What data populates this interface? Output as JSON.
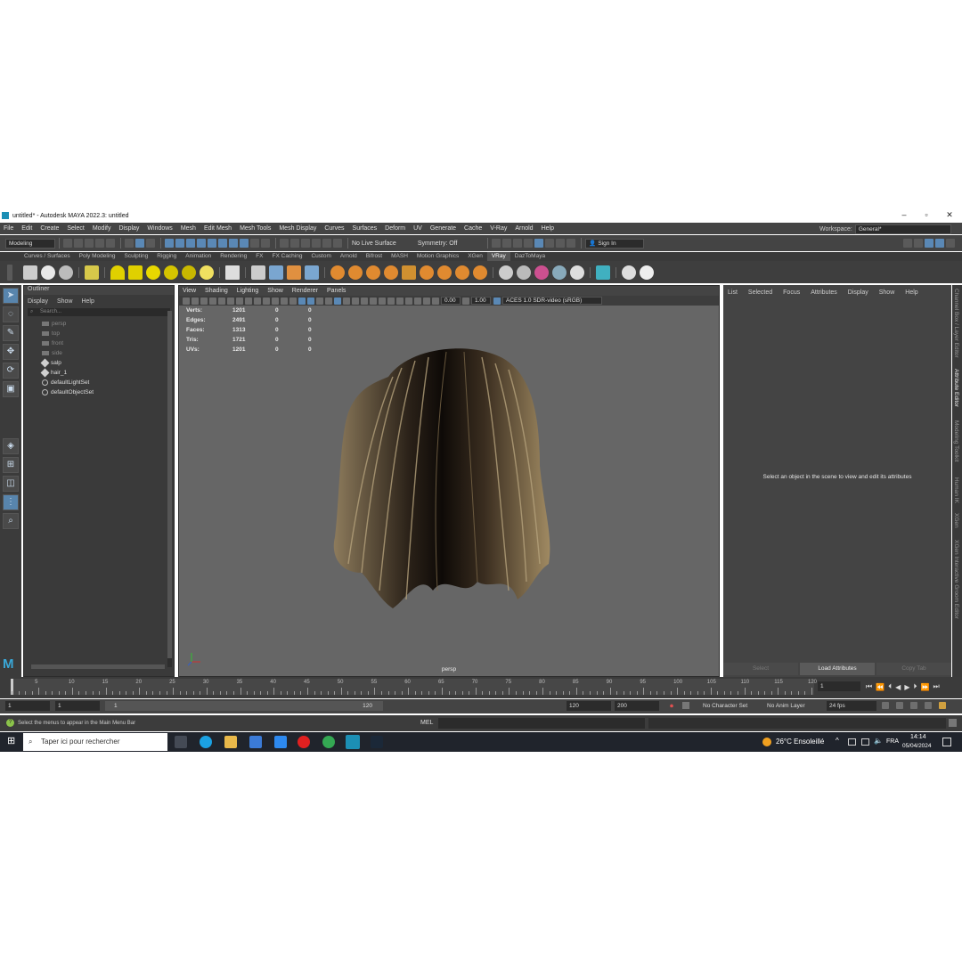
{
  "window": {
    "title": "untitled* - Autodesk MAYA 2022.3: untitled"
  },
  "menubar": {
    "items": [
      "File",
      "Edit",
      "Create",
      "Select",
      "Modify",
      "Display",
      "Windows",
      "Mesh",
      "Edit Mesh",
      "Mesh Tools",
      "Mesh Display",
      "Curves",
      "Surfaces",
      "Deform",
      "UV",
      "Generate",
      "Cache",
      "V-Ray",
      "Arnold",
      "Help"
    ],
    "workspace_label": "Workspace:",
    "workspace_value": "General*"
  },
  "statusline": {
    "mode": "Modeling",
    "live_surface": "No Live Surface",
    "symmetry": "Symmetry: Off",
    "sign_in": "Sign In"
  },
  "shelf": {
    "tabs": [
      "Curves / Surfaces",
      "Poly Modeling",
      "Sculpting",
      "Rigging",
      "Animation",
      "Rendering",
      "FX",
      "FX Caching",
      "Custom",
      "Arnold",
      "Bifrost",
      "MASH",
      "Motion Graphics",
      "XGen",
      "VRay",
      "DazToMaya"
    ],
    "active_tab": "VRay"
  },
  "outliner": {
    "title": "Outliner",
    "menu": [
      "Display",
      "Show",
      "Help"
    ],
    "search_placeholder": "Search...",
    "items": [
      {
        "label": "persp",
        "kind": "camera",
        "dim": true
      },
      {
        "label": "top",
        "kind": "camera",
        "dim": true
      },
      {
        "label": "front",
        "kind": "camera",
        "dim": true
      },
      {
        "label": "side",
        "kind": "camera",
        "dim": true
      },
      {
        "label": "salp",
        "kind": "mesh",
        "dim": false
      },
      {
        "label": "hair_1",
        "kind": "mesh",
        "dim": false
      },
      {
        "label": "defaultLightSet",
        "kind": "set",
        "dim": false
      },
      {
        "label": "defaultObjectSet",
        "kind": "set",
        "dim": false
      }
    ]
  },
  "viewport": {
    "menu": [
      "View",
      "Shading",
      "Lighting",
      "Show",
      "Renderer",
      "Panels"
    ],
    "exposure": "0.00",
    "gamma": "1.00",
    "color_space": "ACES 1.0 SDR-video (sRGB)",
    "camera_label": "persp",
    "hud": [
      {
        "label": "Verts:",
        "a": "1201",
        "b": "0",
        "c": "0"
      },
      {
        "label": "Edges:",
        "a": "2491",
        "b": "0",
        "c": "0"
      },
      {
        "label": "Faces:",
        "a": "1313",
        "b": "0",
        "c": "0"
      },
      {
        "label": "Tris:",
        "a": "1721",
        "b": "0",
        "c": "0"
      },
      {
        "label": "UVs:",
        "a": "1201",
        "b": "0",
        "c": "0"
      }
    ]
  },
  "attribute_editor": {
    "menu": [
      "List",
      "Selected",
      "Focus",
      "Attributes",
      "Display",
      "Show",
      "Help"
    ],
    "message": "Select an object in the scene to view and edit its attributes",
    "buttons": [
      "Select",
      "Load Attributes",
      "Copy Tab"
    ]
  },
  "side_tabs": [
    "Channel Box / Layer Editor",
    "Attribute Editor",
    "Modeling Toolkit",
    "Human IK",
    "XGen",
    "XGen Interactive Groom Editor"
  ],
  "timeline": {
    "ticks": [
      "5",
      "10",
      "15",
      "20",
      "25",
      "30",
      "35",
      "40",
      "45",
      "50",
      "55",
      "60",
      "65",
      "70",
      "75",
      "80",
      "85",
      "90",
      "95",
      "100",
      "105",
      "110",
      "115",
      "120"
    ],
    "current_frame": "1"
  },
  "range": {
    "start": "1",
    "start2": "1",
    "slider_start": "1",
    "slider_end": "120",
    "end": "120",
    "end2": "200",
    "character_set": "No Character Set",
    "anim_layer": "No Anim Layer",
    "fps": "24 fps"
  },
  "commandline": {
    "help_text": "Select the menus to appear in the Main Menu Bar",
    "language": "MEL"
  },
  "taskbar": {
    "search_placeholder": "Taper ici pour rechercher",
    "weather": "26°C  Ensoleillé",
    "language": "FRA",
    "time": "14:14",
    "date": "05/04/2024"
  }
}
